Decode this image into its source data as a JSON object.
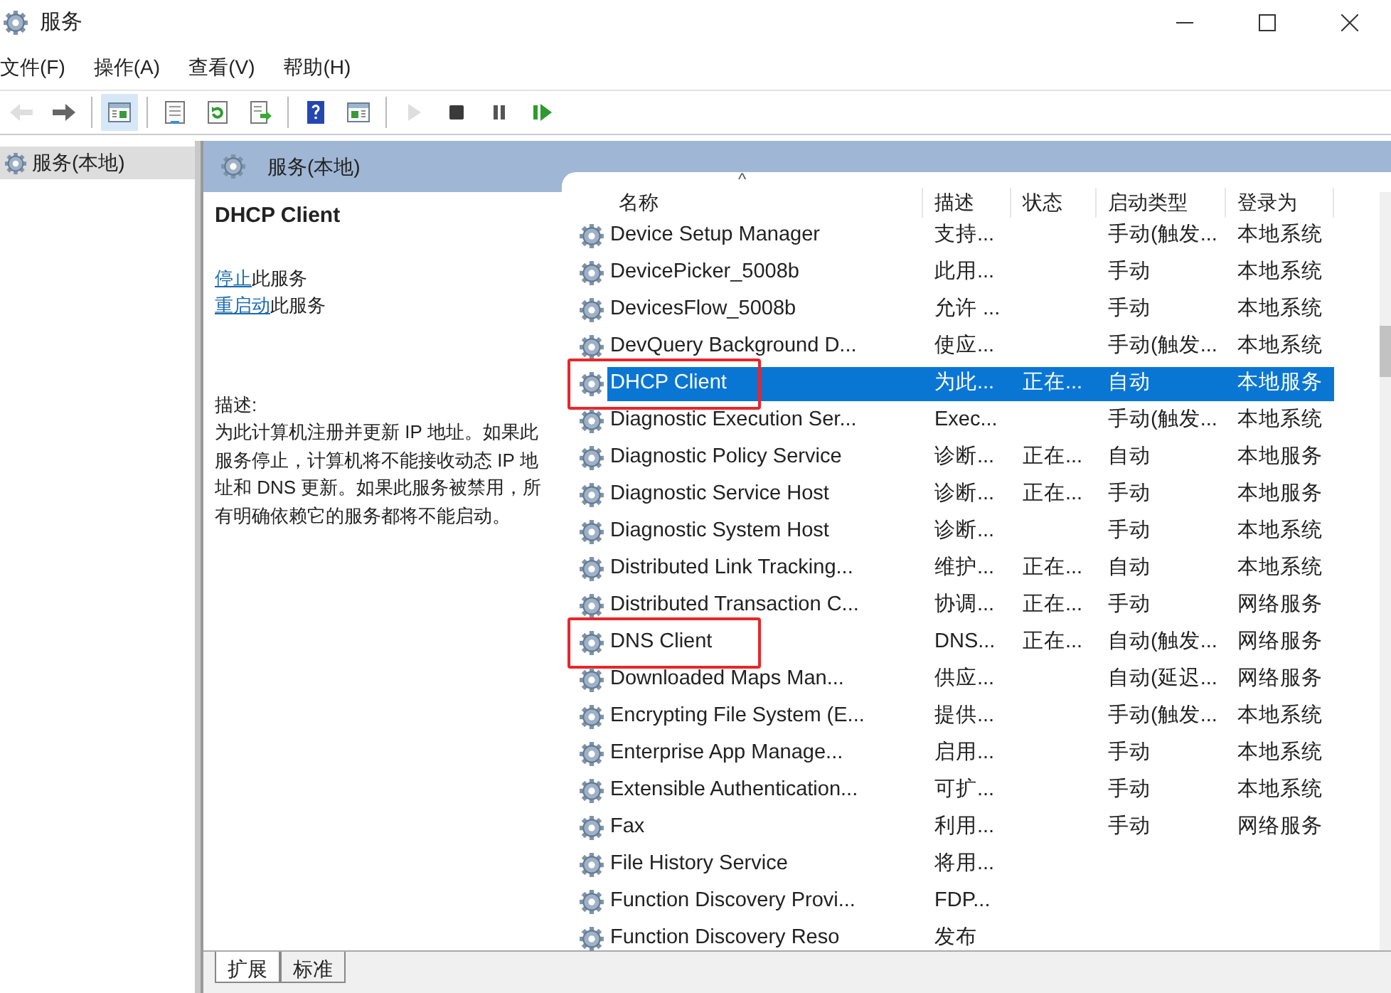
{
  "window": {
    "title": "服务"
  },
  "menu": [
    "文件(F)",
    "操作(A)",
    "查看(V)",
    "帮助(H)"
  ],
  "toolbar": [
    {
      "kind": "back",
      "disabled": true,
      "pressed": false
    },
    {
      "kind": "forward",
      "disabled": false,
      "pressed": false
    },
    {
      "kind": "separator"
    },
    {
      "kind": "console-tree",
      "disabled": false,
      "pressed": true
    },
    {
      "kind": "separator"
    },
    {
      "kind": "properties",
      "disabled": false,
      "pressed": false
    },
    {
      "kind": "refresh",
      "disabled": false,
      "pressed": false
    },
    {
      "kind": "export",
      "disabled": false,
      "pressed": false
    },
    {
      "kind": "separator"
    },
    {
      "kind": "help",
      "disabled": false,
      "pressed": false
    },
    {
      "kind": "action-pane",
      "disabled": false,
      "pressed": false
    },
    {
      "kind": "separator"
    },
    {
      "kind": "start",
      "disabled": true,
      "pressed": false
    },
    {
      "kind": "stop",
      "disabled": false,
      "pressed": false
    },
    {
      "kind": "pause",
      "disabled": false,
      "pressed": false
    },
    {
      "kind": "resume",
      "disabled": false,
      "pressed": false
    }
  ],
  "tree": {
    "items": [
      {
        "label": "服务(本地)",
        "selected": true
      }
    ]
  },
  "pane_header": "服务(本地)",
  "details": {
    "title": "DHCP Client",
    "actions": [
      {
        "link": "停止",
        "text": "此服务"
      },
      {
        "link": "重启动",
        "text": "此服务"
      }
    ],
    "description_label": "描述:",
    "description": "为此计算机注册并更新 IP 地址。如果此服务停止，计算机将不能接收动态 IP 地址和 DNS 更新。如果此服务被禁用，所有明确依赖它的服务都将不能启动。"
  },
  "table": {
    "sort_indicator": "^",
    "columns": [
      "名称",
      "描述",
      "状态",
      "启动类型",
      "登录为"
    ],
    "rows": [
      {
        "name": "Device Setup Manager",
        "description": "支持...",
        "startup": "手动(触发...",
        "logon": "本地系统",
        "selected": false,
        "annotated": false
      },
      {
        "name": "DevicePicker_5008b",
        "description": "此用...",
        "startup": "手动",
        "logon": "本地系统",
        "selected": false,
        "annotated": false
      },
      {
        "name": "DevicesFlow_5008b",
        "description": "允许 ...",
        "startup": "手动",
        "logon": "本地系统",
        "selected": false,
        "annotated": false
      },
      {
        "name": "DevQuery Background D...",
        "description": "使应...",
        "startup": "手动(触发...",
        "logon": "本地系统",
        "selected": false,
        "annotated": false
      },
      {
        "name": "DHCP Client",
        "description": "为此...",
        "status": "正在...",
        "startup": "自动",
        "logon": "本地服务",
        "selected": true,
        "annotated": true
      },
      {
        "name": "Diagnostic Execution Ser...",
        "description": "Exec...",
        "startup": "手动(触发...",
        "logon": "本地系统",
        "selected": false,
        "annotated": false
      },
      {
        "name": "Diagnostic Policy Service",
        "description": "诊断...",
        "status": "正在...",
        "startup": "自动",
        "logon": "本地服务",
        "selected": false,
        "annotated": false
      },
      {
        "name": "Diagnostic Service Host",
        "description": "诊断...",
        "status": "正在...",
        "startup": "手动",
        "logon": "本地服务",
        "selected": false,
        "annotated": false
      },
      {
        "name": "Diagnostic System Host",
        "description": "诊断...",
        "startup": "手动",
        "logon": "本地系统",
        "selected": false,
        "annotated": false
      },
      {
        "name": "Distributed Link Tracking...",
        "description": "维护...",
        "status": "正在...",
        "startup": "自动",
        "logon": "本地系统",
        "selected": false,
        "annotated": false
      },
      {
        "name": "Distributed Transaction C...",
        "description": "协调...",
        "status": "正在...",
        "startup": "手动",
        "logon": "网络服务",
        "selected": false,
        "annotated": false
      },
      {
        "name": "DNS Client",
        "description": "DNS...",
        "status": "正在...",
        "startup": "自动(触发...",
        "logon": "网络服务",
        "selected": false,
        "annotated": true
      },
      {
        "name": "Downloaded Maps Man...",
        "description": "供应...",
        "startup": "自动(延迟...",
        "logon": "网络服务",
        "selected": false,
        "annotated": false
      },
      {
        "name": "Encrypting File System (E...",
        "description": "提供...",
        "startup": "手动(触发...",
        "logon": "本地系统",
        "selected": false,
        "annotated": false
      },
      {
        "name": "Enterprise App Manage...",
        "description": "启用...",
        "startup": "手动",
        "logon": "本地系统",
        "selected": false,
        "annotated": false
      },
      {
        "name": "Extensible Authentication...",
        "description": "可扩...",
        "startup": "手动",
        "logon": "本地系统",
        "selected": false,
        "annotated": false
      },
      {
        "name": "Fax",
        "description": "利用...",
        "startup": "手动",
        "logon": "网络服务",
        "selected": false,
        "annotated": false
      },
      {
        "name": "File History Service",
        "description": "将用...",
        "selected": false,
        "annotated": false
      },
      {
        "name": "Function Discovery Provi...",
        "description": "FDP...",
        "selected": false,
        "annotated": false
      },
      {
        "name": "Function Discovery Reso",
        "description": "发布",
        "selected": false,
        "annotated": false
      }
    ]
  },
  "view_tabs": [
    {
      "label": "扩展",
      "selected": true
    },
    {
      "label": "标准",
      "selected": false
    }
  ]
}
